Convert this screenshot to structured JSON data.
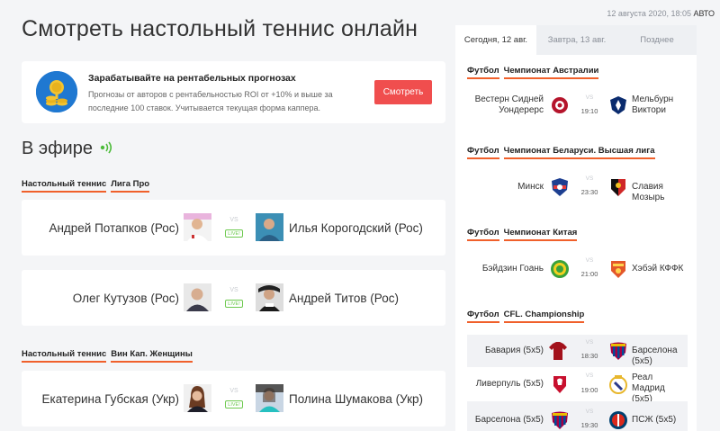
{
  "header": {
    "stamp_date": "12 августа 2020, 18:05",
    "stamp_mode": "АВТО",
    "title": "Смотреть настольный теннис онлайн"
  },
  "promo": {
    "title": "Зарабатывайте на рентабельных прогнозах",
    "text": "Прогнозы от авторов с рентабельностью ROI от +10% и выше за последние 100 ставок. Учитывается текущая форма каппера.",
    "button": "Смотреть"
  },
  "live": {
    "title": "В эфире",
    "vs": "VS",
    "badge": "LIVE!",
    "groups": [
      {
        "sport": "Настольный теннис",
        "league": "Лига Про",
        "matches": [
          {
            "left": "Андрей Потапков (Рос)",
            "right": "Илья Корогодский (Рос)"
          },
          {
            "left": "Олег Кутузов (Рос)",
            "right": "Андрей Титов (Рос)"
          }
        ]
      },
      {
        "sport": "Настольный теннис",
        "league": "Вин Кап. Женщины",
        "matches": [
          {
            "left": "Екатерина Губская (Укр)",
            "right": "Полина Шумакова (Укр)"
          }
        ]
      }
    ]
  },
  "sidebar": {
    "tabs": [
      "Сегодня, 12 авг.",
      "Завтра, 13 авг.",
      "Позднее"
    ],
    "vs": "VS",
    "groups": [
      {
        "sport": "Футбол",
        "league": "Чемпионат Австралии",
        "matches": [
          {
            "home": "Вестерн Сидней Уондерерс",
            "away": "Мельбурн Виктори",
            "time": "19:10"
          }
        ]
      },
      {
        "sport": "Футбол",
        "league": "Чемпионат Беларуси. Высшая лига",
        "matches": [
          {
            "home": "Минск",
            "away": "Славия Мозырь",
            "time": "23:30"
          }
        ]
      },
      {
        "sport": "Футбол",
        "league": "Чемпионат Китая",
        "matches": [
          {
            "home": "Бэйдзин Гоань",
            "away": "Хэбэй КФФК",
            "time": "21:00"
          }
        ]
      },
      {
        "sport": "Футбол",
        "league": "CFL. Championship",
        "matches": [
          {
            "home": "Бавария (5х5)",
            "away": "Барселона (5х5)",
            "time": "18:30"
          },
          {
            "home": "Ливерпуль (5х5)",
            "away": "Реал Мадрид (5х5)",
            "time": "19:00"
          },
          {
            "home": "Барселона (5х5)",
            "away": "ПСЖ (5х5)",
            "time": "19:30"
          }
        ]
      }
    ]
  },
  "colors": {
    "accent": "#f04e4e",
    "underline": "#f0602b",
    "live": "#6dc94e",
    "background": "#f4f5f7"
  }
}
